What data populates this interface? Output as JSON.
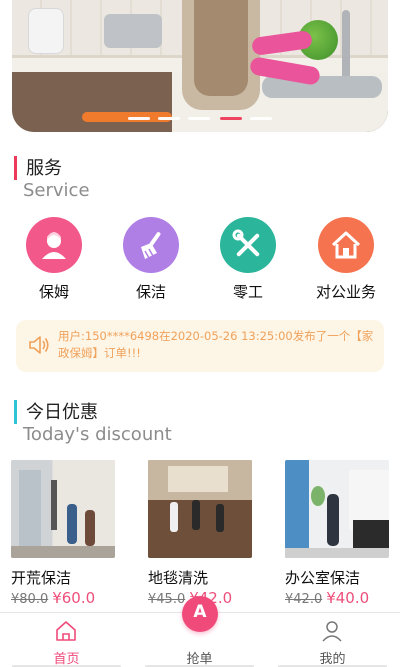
{
  "banner": {
    "slide_count": 5,
    "active_slide": 4
  },
  "service_section": {
    "title": "服务",
    "subtitle": "Service",
    "accent": "#ee3a5a"
  },
  "services": [
    {
      "label": "保姆",
      "icon": "nanny-icon",
      "color": "#f2588a"
    },
    {
      "label": "保洁",
      "icon": "broom-icon",
      "color": "#b07fe6"
    },
    {
      "label": "零工",
      "icon": "tools-icon",
      "color": "#2bb59a"
    },
    {
      "label": "对公业务",
      "icon": "house-icon",
      "color": "#f5744f"
    }
  ],
  "notice": {
    "icon": "speaker-icon",
    "text": "用户:150****6498在2020-05-26 13:25:00发布了一个【家政保姆】订单!!!"
  },
  "discount_section": {
    "title": "今日优惠",
    "subtitle": "Today's discount",
    "accent": "#2ec4d6"
  },
  "deals": [
    {
      "name": "开荒保洁",
      "old_price": "¥80.0",
      "new_price": "¥60.0"
    },
    {
      "name": "地毯清洗",
      "old_price": "¥45.0",
      "new_price": "¥42.0"
    },
    {
      "name": "办公室保洁",
      "old_price": "¥42.0",
      "new_price": "¥40.0"
    }
  ],
  "tabbar": {
    "tabs": [
      {
        "label": "首页",
        "icon": "home-icon",
        "active": true
      },
      {
        "label": "抢单",
        "icon": "grab-order-icon",
        "active": false
      },
      {
        "label": "我的",
        "icon": "user-icon",
        "active": false
      }
    ],
    "fab_glyph": "A",
    "active_color": "#f04a7b",
    "inactive_color": "#555555"
  }
}
